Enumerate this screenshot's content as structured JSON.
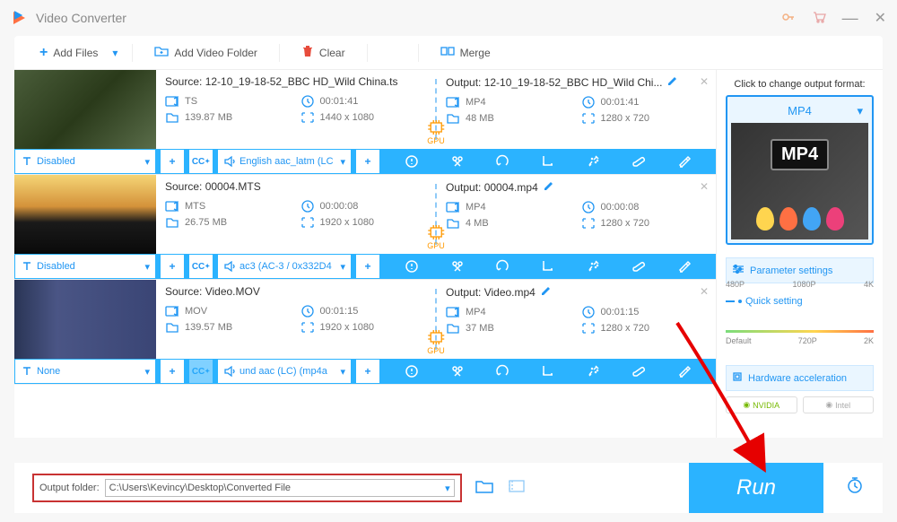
{
  "app": {
    "title": "Video Converter"
  },
  "toolbar": {
    "add_files": "Add Files",
    "add_folder": "Add Video Folder",
    "clear": "Clear",
    "merge": "Merge"
  },
  "files": [
    {
      "source_label": "Source: 12-10_19-18-52_BBC HD_Wild China.ts",
      "src": {
        "format": "TS",
        "duration": "00:01:41",
        "size": "139.87 MB",
        "res": "1440 x 1080"
      },
      "output_label": "Output: 12-10_19-18-52_BBC HD_Wild Chi...",
      "out": {
        "format": "MP4",
        "duration": "00:01:41",
        "size": "48 MB",
        "res": "1280 x 720"
      },
      "subtitle": "Disabled",
      "audio": "English aac_latm (LC",
      "cc_enabled": true
    },
    {
      "source_label": "Source: 00004.MTS",
      "src": {
        "format": "MTS",
        "duration": "00:00:08",
        "size": "26.75 MB",
        "res": "1920 x 1080"
      },
      "output_label": "Output: 00004.mp4",
      "out": {
        "format": "MP4",
        "duration": "00:00:08",
        "size": "4 MB",
        "res": "1280 x 720"
      },
      "subtitle": "Disabled",
      "audio": "ac3 (AC-3 / 0x332D4",
      "cc_enabled": true
    },
    {
      "source_label": "Source: Video.MOV",
      "src": {
        "format": "MOV",
        "duration": "00:01:15",
        "size": "139.57 MB",
        "res": "1920 x 1080"
      },
      "output_label": "Output: Video.mp4",
      "out": {
        "format": "MP4",
        "duration": "00:01:15",
        "size": "37 MB",
        "res": "1280 x 720"
      },
      "subtitle": "None",
      "audio": "und aac (LC) (mp4a",
      "cc_enabled": false
    }
  ],
  "gpu_label": "GPU",
  "right": {
    "title": "Click to change output format:",
    "format": "MP4",
    "param_settings": "Parameter settings",
    "quick_setting": "Quick setting",
    "slider_top": {
      "a": "480P",
      "b": "1080P",
      "c": "4K"
    },
    "slider_bot": {
      "a": "Default",
      "b": "720P",
      "c": "2K"
    },
    "hw_accel": "Hardware acceleration",
    "nvidia": "NVIDIA",
    "intel": "Intel"
  },
  "footer": {
    "label": "Output folder:",
    "path": "C:\\Users\\Kevincy\\Desktop\\Converted File",
    "run": "Run"
  }
}
